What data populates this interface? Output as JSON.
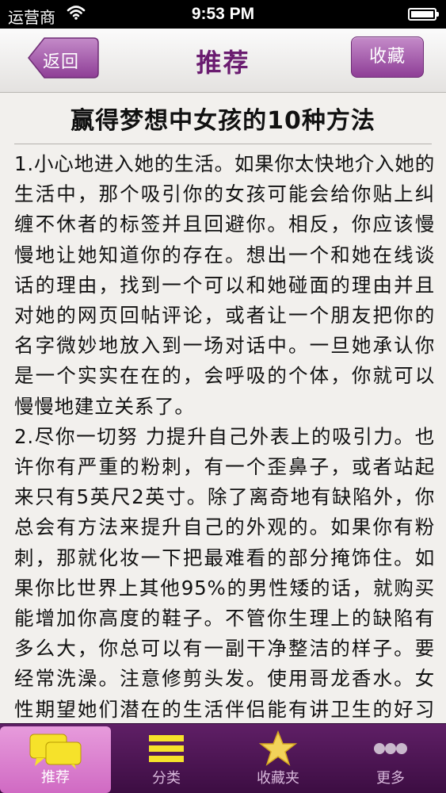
{
  "status": {
    "carrier": "运营商",
    "time": "9:53 PM"
  },
  "nav": {
    "back_label": "返回",
    "title": "推荐",
    "favorite_label": "收藏"
  },
  "article": {
    "title": "赢得梦想中女孩的10种方法",
    "paragraphs": [
      "1.小心地进入她的生活。如果你太快地介入她的生活中，那个吸引你的女孩可能会给你贴上纠缠不休者的标签并且回避你。相反，你应该慢慢地让她知道你的存在。想出一个和她在线谈话的理由，找到一个可以和她碰面的理由并且对她的网页回帖评论，或者让一个朋友把你的名字微妙地放入到一场对话中。一旦她承认你是一个实实在在的，会呼吸的个体，你就可以慢慢地建立关系了。",
      "2.尽你一切努 力提升自己外表上的吸引力。也许你有严重的粉刺，有一个歪鼻子，或者站起来只有5英尺2英寸。除了离奇地有缺陷外，你总会有方法来提升自己的外观的。如果你有粉刺，那就化妆一下把最难看的部分掩饰住。如果你比世界上其他95%的男性矮的话，就购买能增加你高度的鞋子。不管你生理上的缺陷有多么大，你总可以有一副干净整洁的样子。要经常洗澡。注意修剪头发。使用哥龙香水。女性期望她们潜在的生活伴侣能有讲卫生的好习惯，因此即使你缺少外表上吸引力"
    ]
  },
  "tabs": [
    {
      "label": "推荐",
      "icon": "chat-bubbles-icon",
      "active": true
    },
    {
      "label": "分类",
      "icon": "list-icon",
      "active": false
    },
    {
      "label": "收藏夹",
      "icon": "star-icon",
      "active": false
    },
    {
      "label": "更多",
      "icon": "more-dots-icon",
      "active": false
    }
  ],
  "colors": {
    "accent": "#6a1c70",
    "tab_bar": "#4b1451",
    "tab_active": "#d97ccd",
    "background": "#f2f0ed"
  }
}
